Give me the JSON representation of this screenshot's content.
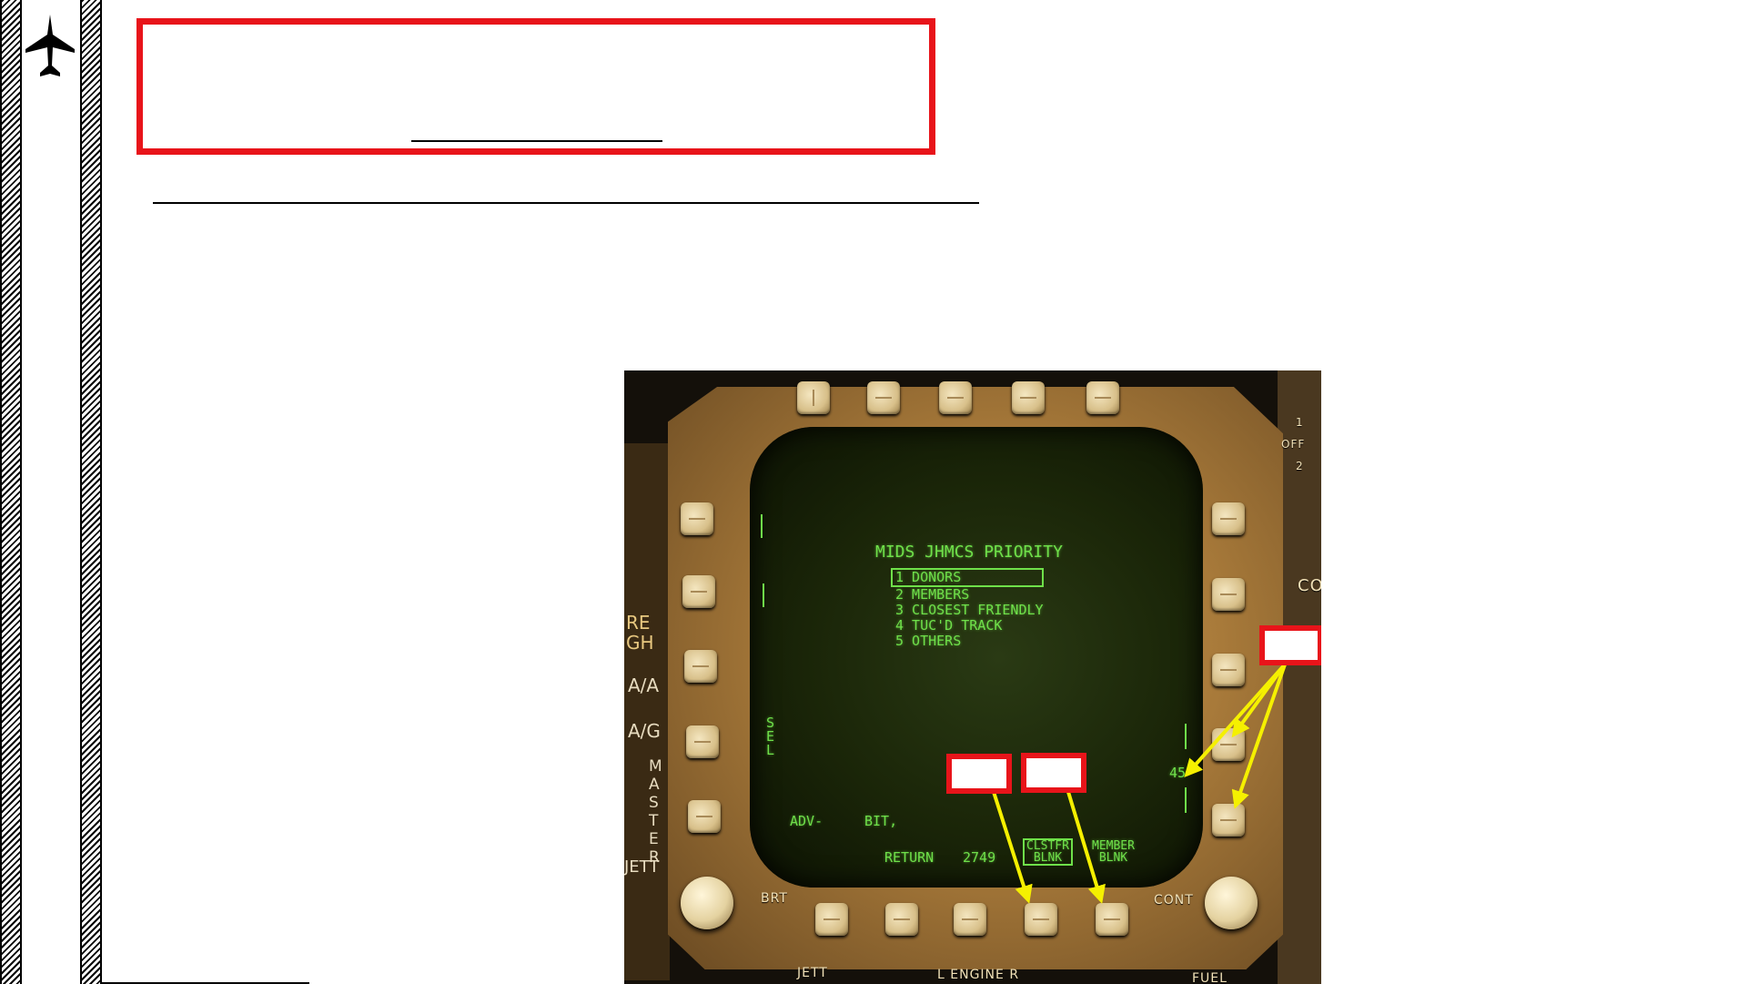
{
  "mfd": {
    "title": "MIDS JHMCS PRIORITY",
    "priority_items": [
      "1 DONORS",
      "2 MEMBERS",
      "3 CLOSEST FRIENDLY",
      "4 TUC'D TRACK",
      "5 OTHERS"
    ],
    "sel_label": "SEL",
    "value_45": "45",
    "adv_label": "ADV-",
    "bit_label": "BIT,",
    "return_label": "RETURN",
    "return_value": "2749",
    "clstfr_blnk": [
      "CLSTFR",
      "BLNK"
    ],
    "member_blnk": [
      "MEMBER",
      "BLNK"
    ]
  },
  "bezel_labels": {
    "brt": "BRT",
    "cont": "CONT",
    "jett": "JETT",
    "l_engine_r": "L ENGINE R",
    "fuel": "FUEL",
    "switch_1": "1",
    "switch_off": "OFF",
    "switch_2": "2",
    "co": "CO"
  },
  "left_panel": {
    "aa": "A/A",
    "ag": "A/G",
    "master": "MASTER",
    "jett": "JETT",
    "re": "RE",
    "gh": "GH"
  },
  "colors": {
    "callout_red": "#e8141a",
    "arrow_yellow": "#f5f000",
    "screen_green": "#6fe04a"
  }
}
